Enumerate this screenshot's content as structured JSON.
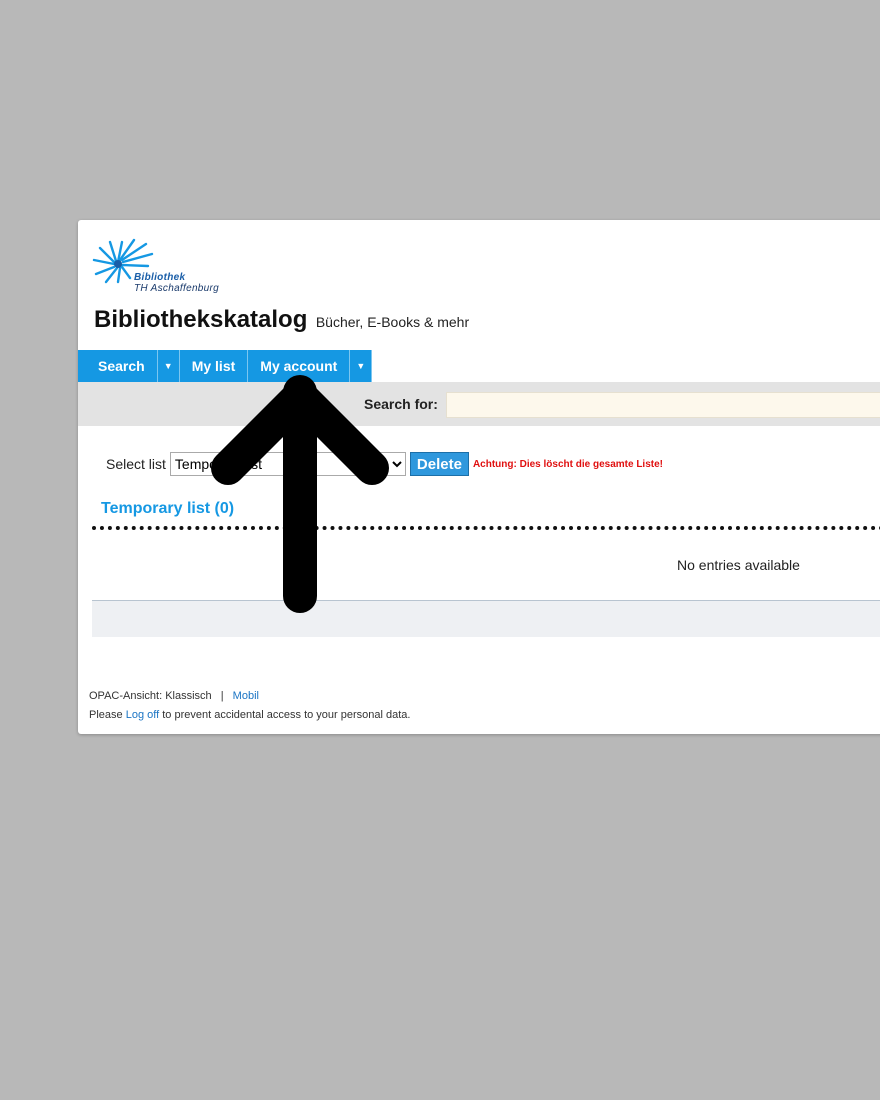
{
  "logo": {
    "line1": "Bibliothek",
    "line2": "TH Aschaffenburg",
    "icon": "burst-logo-icon"
  },
  "header": {
    "title": "Bibliothekskatalog",
    "subtitle": "Bücher, E-Books & mehr"
  },
  "nav": {
    "search_label": "Search",
    "mylist_label": "My list",
    "account_label": "My account"
  },
  "search": {
    "label": "Search for:",
    "value": ""
  },
  "list_select": {
    "label": "Select list",
    "selected": "Temporary list",
    "delete_label": "Delete",
    "warning": "Achtung: Dies löscht die gesamte Liste!"
  },
  "list": {
    "title": "Temporary list (0)",
    "empty_message": "No entries available"
  },
  "footer": {
    "view_label": "OPAC-Ansicht:",
    "view_current": "Klassisch",
    "separator": "|",
    "view_mobile": "Mobil",
    "please": "Please",
    "logoff_link": "Log off",
    "logoff_text": "to prevent accidental access to your personal data."
  },
  "colors": {
    "nav_blue": "#1598e3",
    "warning_red": "#e01010",
    "background_gray": "#b8b8b8",
    "search_bar_gray": "#e3e3e3"
  },
  "annotation": {
    "icon": "up-arrow-icon",
    "target": "My account"
  }
}
